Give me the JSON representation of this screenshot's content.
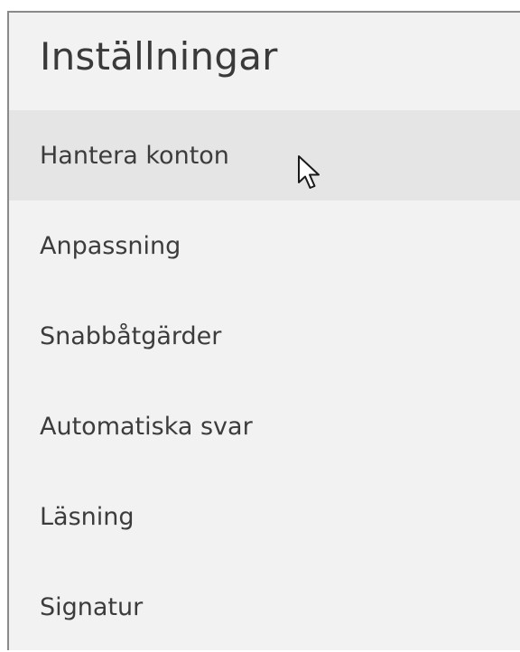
{
  "settings": {
    "title": "Inställningar",
    "items": [
      {
        "label": "Hantera konton",
        "state": "hovered"
      },
      {
        "label": "Anpassning"
      },
      {
        "label": "Snabbåtgärder"
      },
      {
        "label": "Automatiska svar"
      },
      {
        "label": "Läsning"
      },
      {
        "label": "Signatur"
      }
    ]
  },
  "colors": {
    "panel_background": "#f2f2f2",
    "hover_background": "#e5e5e5",
    "text": "#3c3c3c"
  },
  "icons": {
    "pointer": "mouse-pointer-icon"
  }
}
